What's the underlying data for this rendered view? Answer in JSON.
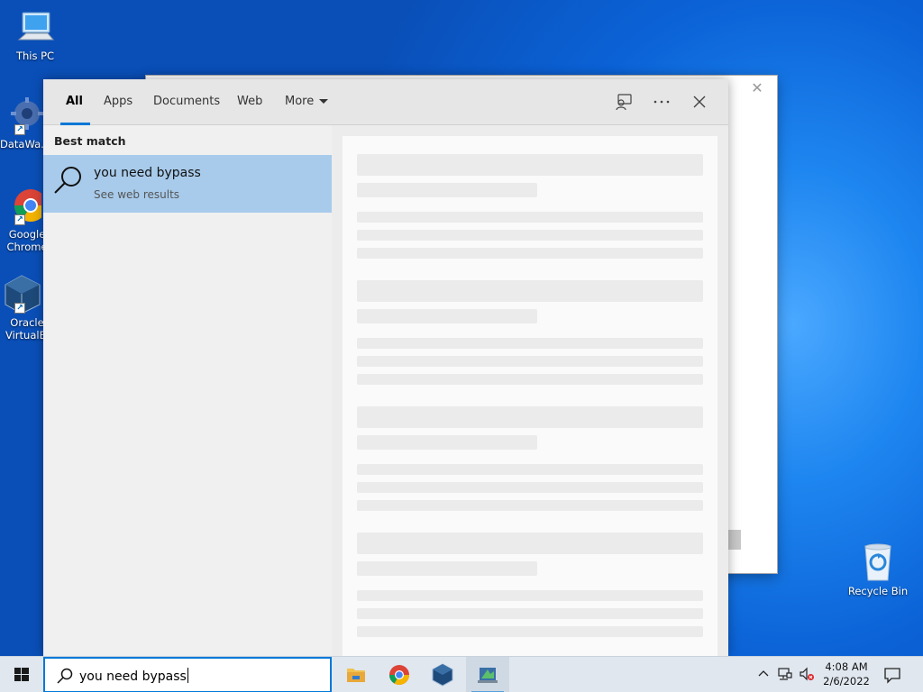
{
  "desktop": {
    "icons": [
      {
        "label": "This PC"
      },
      {
        "label": "DataWa..."
      },
      {
        "label": "Google Chrome"
      },
      {
        "label": "Oracle VirtualBox"
      },
      {
        "label": "Recycle Bin"
      }
    ]
  },
  "search_flyout": {
    "tabs": [
      {
        "label": "All",
        "active": true
      },
      {
        "label": "Apps"
      },
      {
        "label": "Documents"
      },
      {
        "label": "Web"
      },
      {
        "label": "More"
      }
    ],
    "toolbar": {
      "feedback_icon": "feedback-icon",
      "more_icon": "ellipsis-icon",
      "close_icon": "close-icon"
    },
    "best_match_header": "Best match",
    "best_match": {
      "title": "you need bypass",
      "subtitle": "See web results",
      "icon": "search-icon"
    }
  },
  "taskbar": {
    "search_value": "you need bypass",
    "apps": [
      "file-explorer-icon",
      "chrome-icon",
      "virtualbox-icon",
      "app-icon"
    ],
    "tray": [
      "chevron-up-icon",
      "network-icon",
      "volume-muted-icon"
    ],
    "clock": {
      "time": "4:08 AM",
      "date": "2/6/2022"
    },
    "notification_icon": "action-center-icon"
  },
  "colors": {
    "accent": "#0078d7",
    "selection": "#a8cbeb",
    "desktop": "#0b62d6"
  }
}
